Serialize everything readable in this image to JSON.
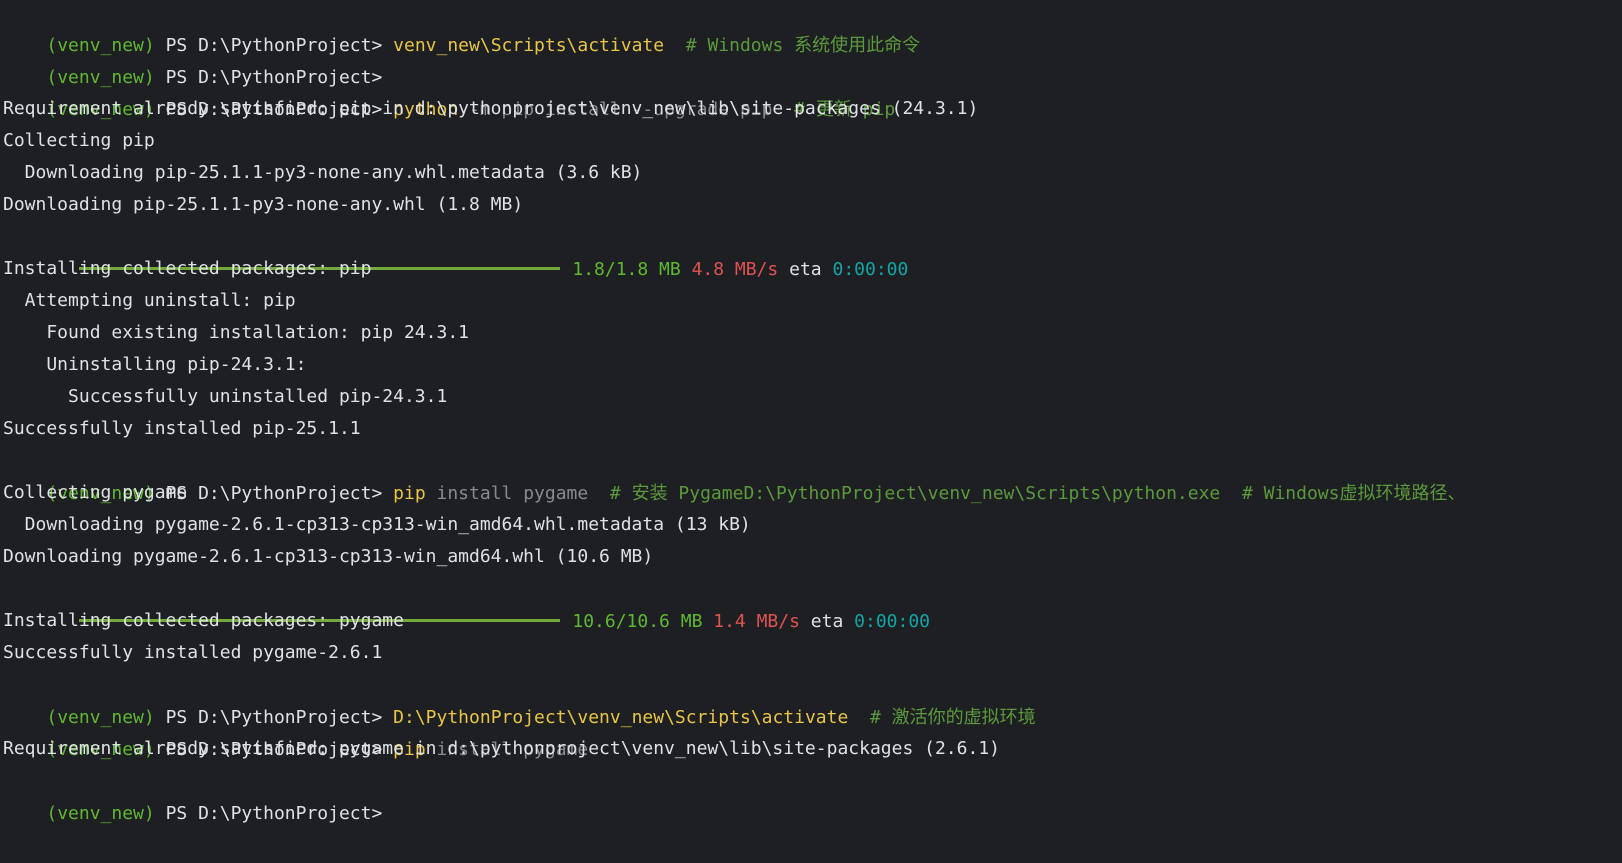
{
  "lines": [
    {
      "venv": "(venv_new)",
      "ps": " PS D:\\PythonProject> ",
      "cmd": "venv_new\\Scripts\\activate",
      "arg": "",
      "cmt": "  # Windows 系统使用此命令"
    },
    {
      "venv": "(venv_new)",
      "ps": " PS D:\\PythonProject>"
    },
    {
      "venv": "(venv_new)",
      "ps": " PS D:\\PythonProject> ",
      "cmd": "python",
      "arg": " -m pip install --upgrade pip",
      "cmt": "  # 更新 pip"
    },
    {
      "out": "Requirement already satisfied: pip in d:\\pythonproject\\venv_new\\lib\\site-packages (24.3.1)"
    },
    {
      "out": "Collecting pip"
    },
    {
      "out": "  Downloading pip-25.1.1-py3-none-any.whl.metadata (3.6 kB)"
    },
    {
      "out": "Downloading pip-25.1.1-py3-none-any.whl (1.8 MB)"
    },
    {
      "progress": {
        "fraction": 1.0,
        "size": "1.8/1.8 MB",
        "speed": "4.8 MB/s",
        "eta_label": "eta",
        "eta": "0:00:00"
      }
    },
    {
      "out": "Installing collected packages: pip"
    },
    {
      "out": "  Attempting uninstall: pip"
    },
    {
      "out": "    Found existing installation: pip 24.3.1"
    },
    {
      "out": "    Uninstalling pip-24.3.1:"
    },
    {
      "out": "      Successfully uninstalled pip-24.3.1"
    },
    {
      "out": "Successfully installed pip-25.1.1"
    },
    {
      "venv": "(venv_new)",
      "ps": " PS D:\\PythonProject> ",
      "cmd": "pip",
      "arg": " install pygame",
      "cmt": "  # 安装 PygameD:\\PythonProject\\venv_new\\Scripts\\python.exe  # Windows虚拟环境路径、"
    },
    {
      "out": "Collecting pygame"
    },
    {
      "out": "  Downloading pygame-2.6.1-cp313-cp313-win_amd64.whl.metadata (13 kB)"
    },
    {
      "out": "Downloading pygame-2.6.1-cp313-cp313-win_amd64.whl (10.6 MB)"
    },
    {
      "progress": {
        "fraction": 1.0,
        "size": "10.6/10.6 MB",
        "speed": "1.4 MB/s",
        "eta_label": "eta",
        "eta": "0:00:00"
      }
    },
    {
      "out": "Installing collected packages: pygame"
    },
    {
      "out": "Successfully installed pygame-2.6.1"
    },
    {
      "venv": "(venv_new)",
      "ps": " PS D:\\PythonProject> ",
      "cmd": "D:\\PythonProject\\venv_new\\Scripts\\activate",
      "arg": "",
      "cmt": "  # 激活你的虚拟环境"
    },
    {
      "venv": "(venv_new)",
      "ps": " PS D:\\PythonProject> ",
      "cmd": "pip",
      "arg": " install pygame",
      "cmt": ""
    },
    {
      "out": "Requirement already satisfied: pygame in d:\\pythonproject\\venv_new\\lib\\site-packages (2.6.1)"
    },
    {
      "venv": "(venv_new)",
      "ps": " PS D:\\PythonProject>"
    }
  ],
  "colors": {
    "background": "#1e1f22",
    "venv": "#5fb832",
    "command": "#e8c547",
    "argument": "#868a91",
    "comment": "#5a9a3c",
    "progress_bar": "#74a83a",
    "speed": "#e05252",
    "eta": "#12a5a5"
  }
}
